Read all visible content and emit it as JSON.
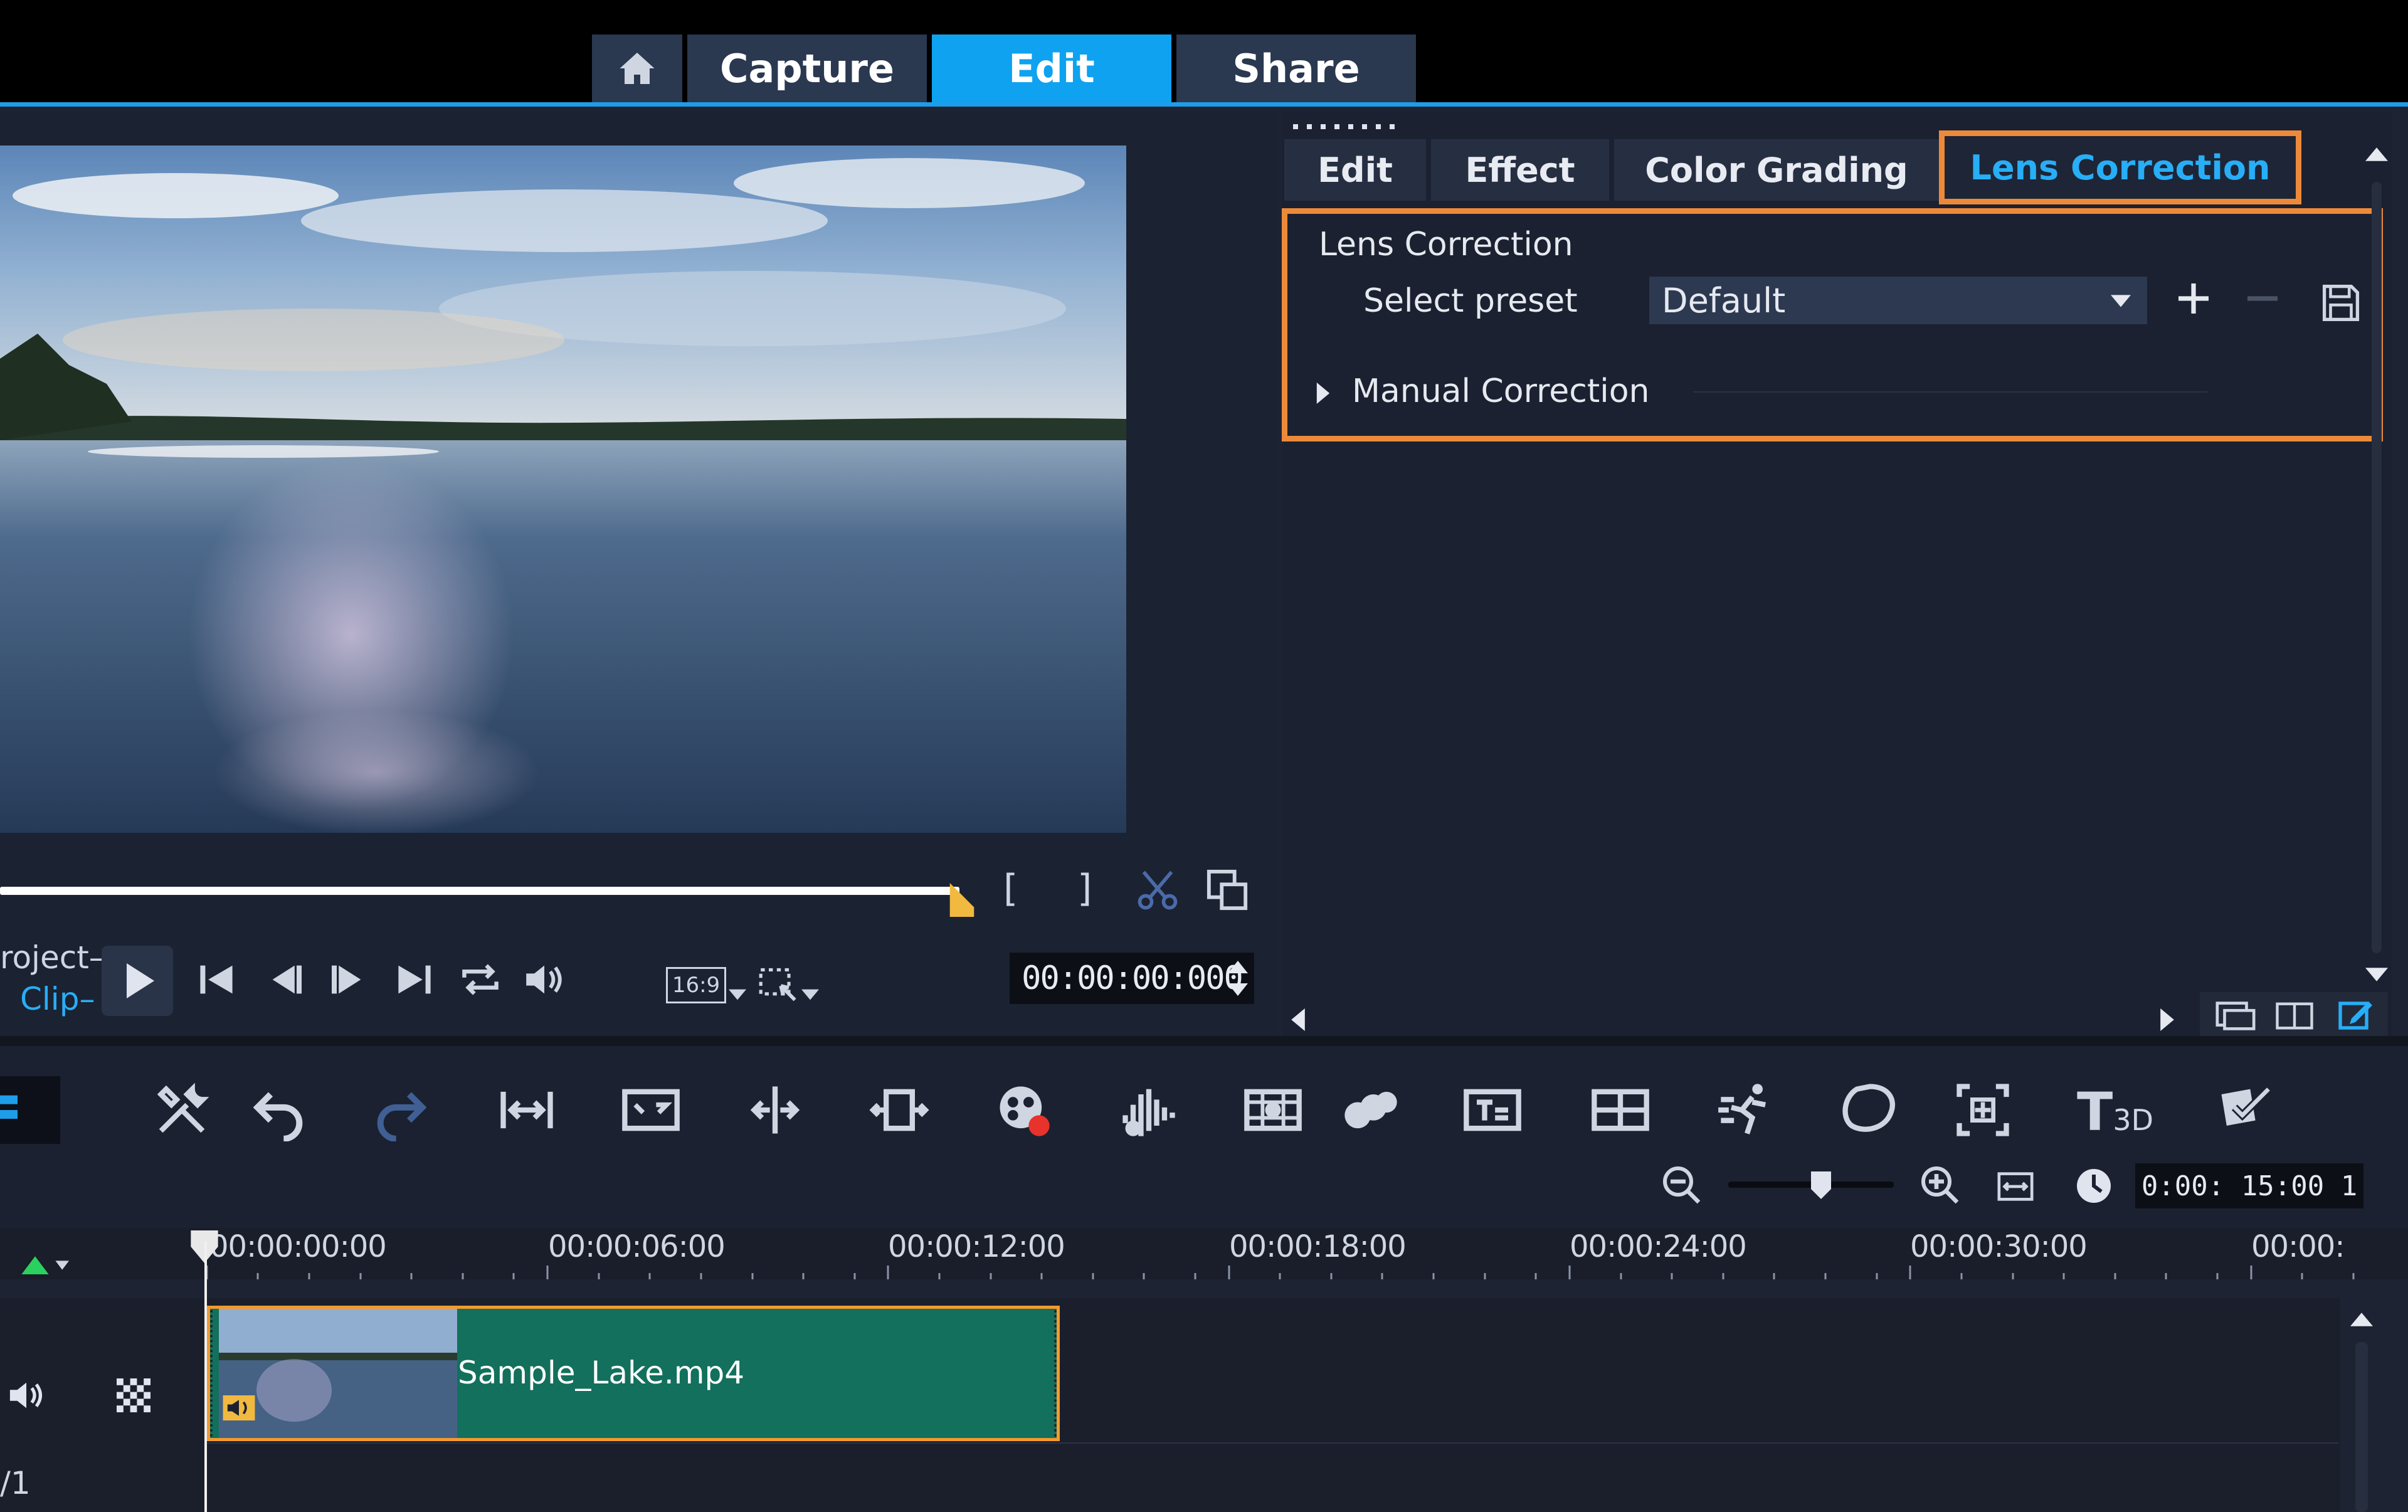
{
  "top_tabs": {
    "home_icon": "home-icon",
    "capture": "Capture",
    "edit": "Edit",
    "share": "Share",
    "active": "Edit"
  },
  "player": {
    "mode_project": "roject",
    "mode_clip": "Clip",
    "aspect_ratio": "16:9",
    "timecode": "00:00:00:000"
  },
  "panel": {
    "tabs": [
      "Edit",
      "Effect",
      "Color Grading",
      "Lens Correction"
    ],
    "active_tab": "Lens Correction",
    "section_title": "Lens Correction",
    "preset_label": "Select preset",
    "preset_value": "Default",
    "manual_label": "Manual Correction"
  },
  "timeline": {
    "zoom_time": "0:00: 15:00 1",
    "ruler_labels": [
      "00:00:00:00",
      "00:00:06:00",
      "00:00:12:00",
      "00:00:18:00",
      "00:00:24:00",
      "00:00:30:00",
      "00:00:"
    ],
    "clip_name": "Sample_Lake.mp4",
    "track_label": "/1"
  },
  "colors": {
    "accent": "#0ea2f0",
    "highlight": "#ec8a3a",
    "clip": "#12705c"
  }
}
